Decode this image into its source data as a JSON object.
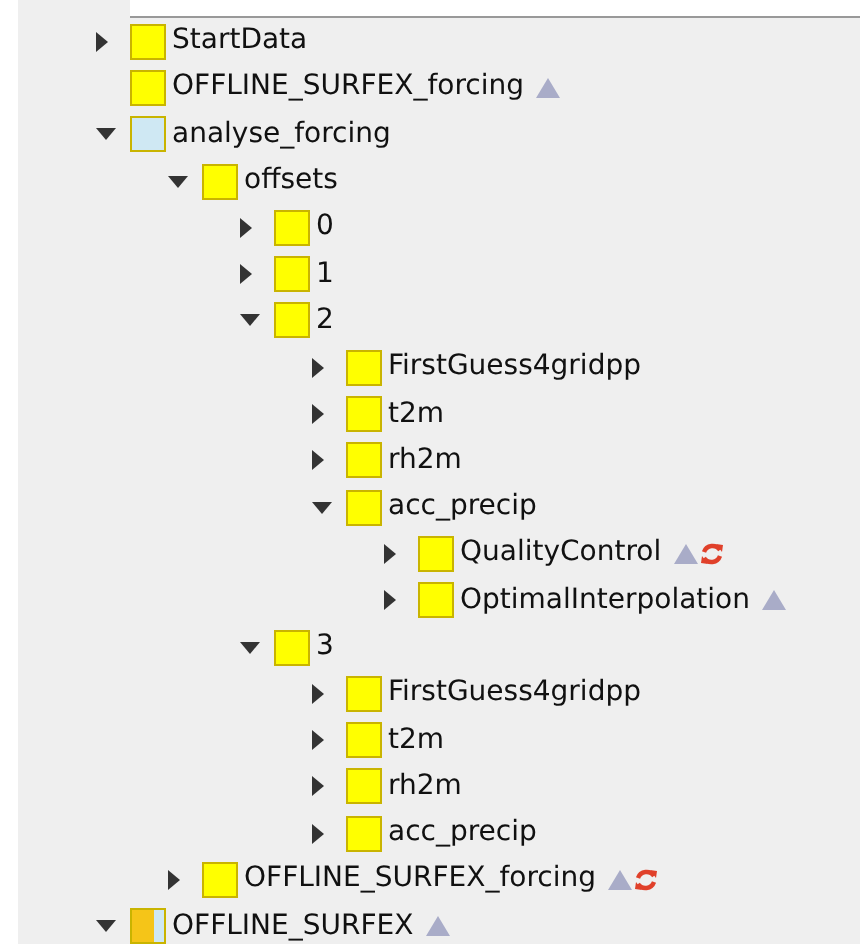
{
  "tree": [
    {
      "label": "StartData",
      "expanded": false,
      "color": "#ffff00"
    },
    {
      "label": "OFFLINE_SURFEX_forcing",
      "leaf": true,
      "color": "#ffff00",
      "triangle": true
    },
    {
      "label": "analyse_forcing",
      "expanded": true,
      "color": "#cfe8f3",
      "children": [
        {
          "label": "offsets",
          "expanded": true,
          "color": "#ffff00",
          "children": [
            {
              "label": "0",
              "expanded": false,
              "color": "#ffff00"
            },
            {
              "label": "1",
              "expanded": false,
              "color": "#ffff00"
            },
            {
              "label": "2",
              "expanded": true,
              "color": "#ffff00",
              "children": [
                {
                  "label": "FirstGuess4gridpp",
                  "expanded": false,
                  "color": "#ffff00"
                },
                {
                  "label": "t2m",
                  "expanded": false,
                  "color": "#ffff00"
                },
                {
                  "label": "rh2m",
                  "expanded": false,
                  "color": "#ffff00"
                },
                {
                  "label": "acc_precip",
                  "expanded": true,
                  "color": "#ffff00",
                  "children": [
                    {
                      "label": "QualityControl",
                      "expanded": false,
                      "color": "#ffff00",
                      "triangle": true,
                      "refresh": true
                    },
                    {
                      "label": "OptimalInterpolation",
                      "expanded": false,
                      "color": "#ffff00",
                      "triangle": true
                    }
                  ]
                }
              ]
            },
            {
              "label": "3",
              "expanded": true,
              "color": "#ffff00",
              "children": [
                {
                  "label": "FirstGuess4gridpp",
                  "expanded": false,
                  "color": "#ffff00"
                },
                {
                  "label": "t2m",
                  "expanded": false,
                  "color": "#ffff00"
                },
                {
                  "label": "rh2m",
                  "expanded": false,
                  "color": "#ffff00"
                },
                {
                  "label": "acc_precip",
                  "expanded": false,
                  "color": "#ffff00"
                }
              ]
            }
          ]
        },
        {
          "label": "OFFLINE_SURFEX_forcing",
          "expanded": false,
          "color": "#ffff00",
          "triangle": true,
          "refresh": true
        }
      ]
    },
    {
      "label": "OFFLINE_SURFEX",
      "expanded": true,
      "color": "#f5c518",
      "split": true,
      "triangle": true
    }
  ]
}
